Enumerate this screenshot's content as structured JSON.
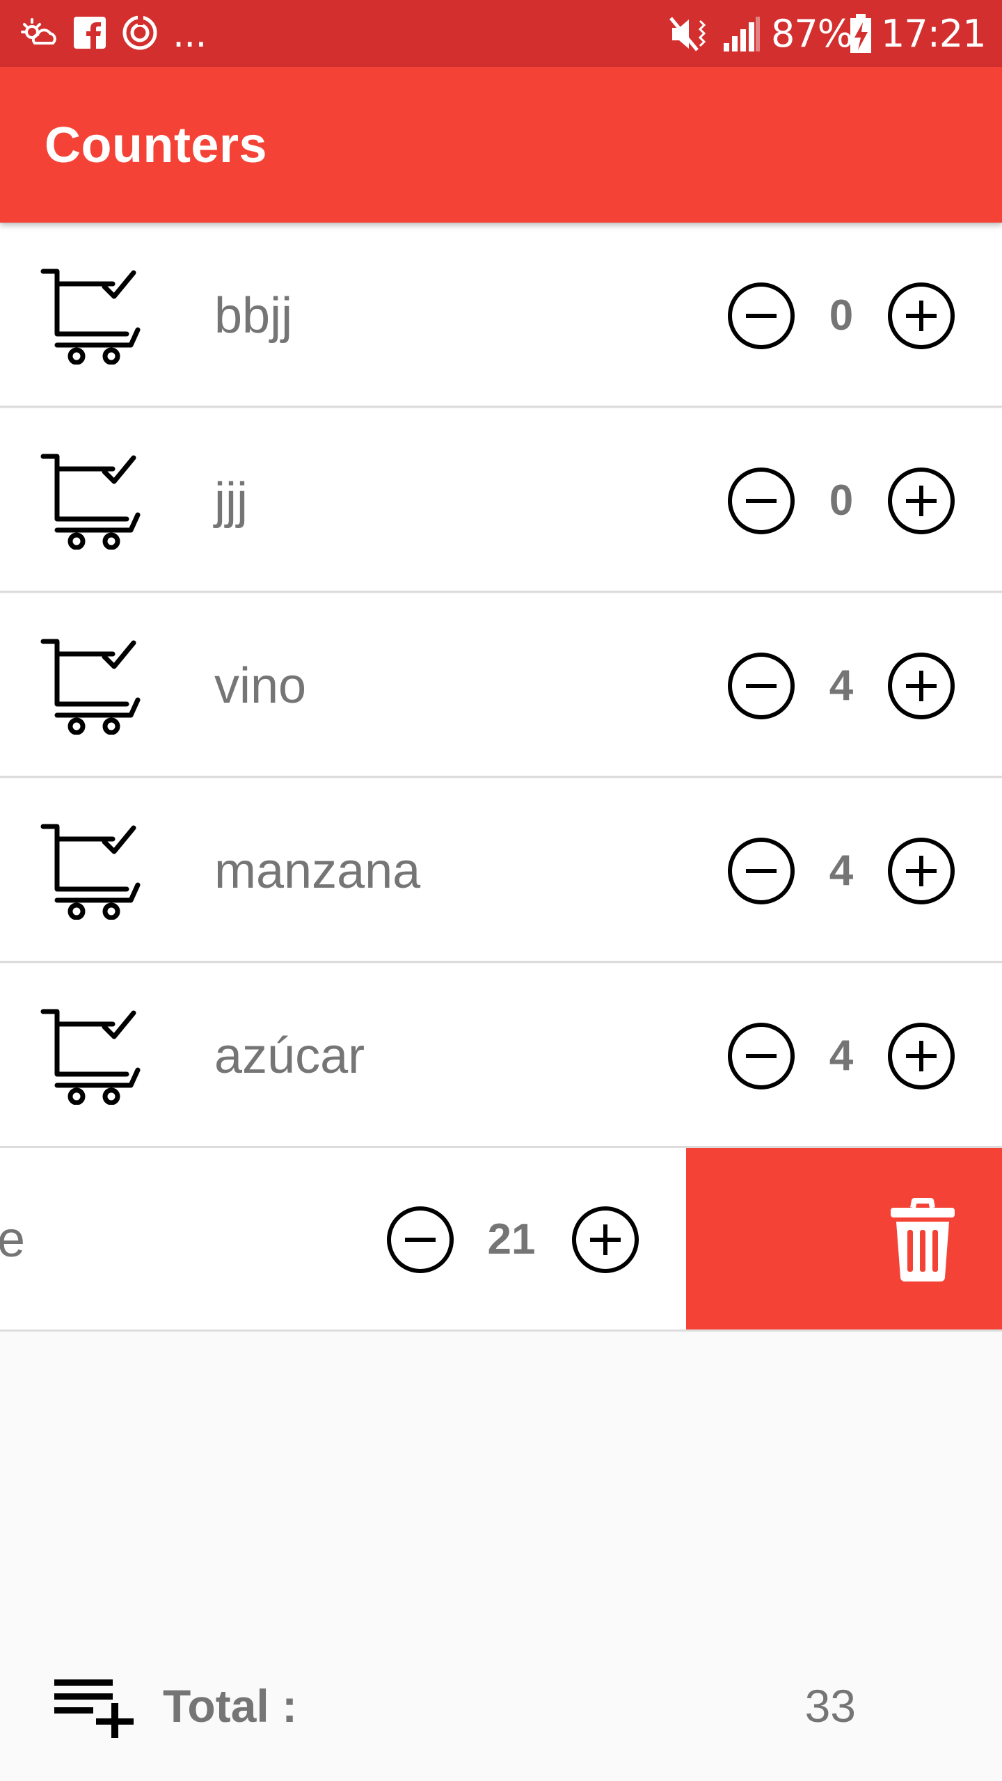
{
  "status_bar": {
    "left_icons": [
      "weather-icon",
      "facebook-icon",
      "sync-icon"
    ],
    "more": "...",
    "battery": "87%",
    "time": "17:21",
    "color": "#d32f2f"
  },
  "app_bar": {
    "title": "Counters",
    "color": "#f44336"
  },
  "items": [
    {
      "name": "bbjj",
      "count": "0"
    },
    {
      "name": "jjj",
      "count": "0"
    },
    {
      "name": "vino",
      "count": "4"
    },
    {
      "name": "manzana",
      "count": "4"
    },
    {
      "name": "azúcar",
      "count": "4"
    }
  ],
  "swiped_item": {
    "name_visible": "e",
    "count": "21",
    "delete_icon": "trash-icon"
  },
  "footer": {
    "add_icon": "playlist-add-icon",
    "total_label": "Total :",
    "total_value": "33"
  }
}
